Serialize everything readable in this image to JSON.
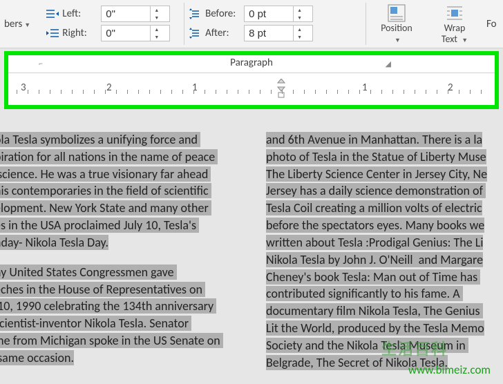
{
  "ribbon": {
    "numbers_label": "bers",
    "indent": {
      "left_label": "Left:",
      "left_value": "0\"",
      "right_label": "Right:",
      "right_value": "0\""
    },
    "spacing": {
      "before_label": "Before:",
      "before_value": "0 pt",
      "after_label": "After:",
      "after_value": "8 pt"
    },
    "position_label": "Position",
    "wrap_label_line1": "Wrap",
    "wrap_label_line2": "Text",
    "format_fragment": "Fo"
  },
  "paragraph_caption": "Paragraph",
  "ruler_marks": [
    "3",
    "2",
    "1",
    "1",
    "2"
  ],
  "doc": {
    "left_p1": "ola Tesla symbolizes a unifying force and \npiration for all nations in the name of peace \n science. He was a true visionary far ahead \nhis contemporaries in the field of scientific \nelopment. New York State and many other \nes in the USA proclaimed July 10, Tesla's \nhday- Nikola Tesla Day.",
    "left_p2": "ny United States Congressmen gave \neches in the House of Representatives on \n 10, 1990 celebrating the 134th anniversary \nscientist-inventor Nikola Tesla. Senator \nine from Michigan spoke in the US Senate on \n same occasion.",
    "right_p1": "and 6th Avenue in Manhattan. There is a la\nphoto of Tesla in the Statue of Liberty Muse\nThe Liberty Science Center in Jersey City, Ne\nJersey has a daily science demonstration of \nTesla Coil creating a million volts of electric\nbefore the spectators eyes. Many books we\nwritten about Tesla :Prodigal Genius: The Li\nNikola Tesla by John J. O'Neill  and Margare\nCheney's book Tesla: Man out of Time has \ncontributed significantly to his fame. A \ndocumentary film Nikola Tesla, The Genius \nLit the World, produced by the Tesla Memo\nSociety and the Nikola Tesla Museum in \nBelgrade, The Secret of Nikola Tesla."
  },
  "watermark1": "生活百科",
  "watermark2": "www.bimeiz.com"
}
